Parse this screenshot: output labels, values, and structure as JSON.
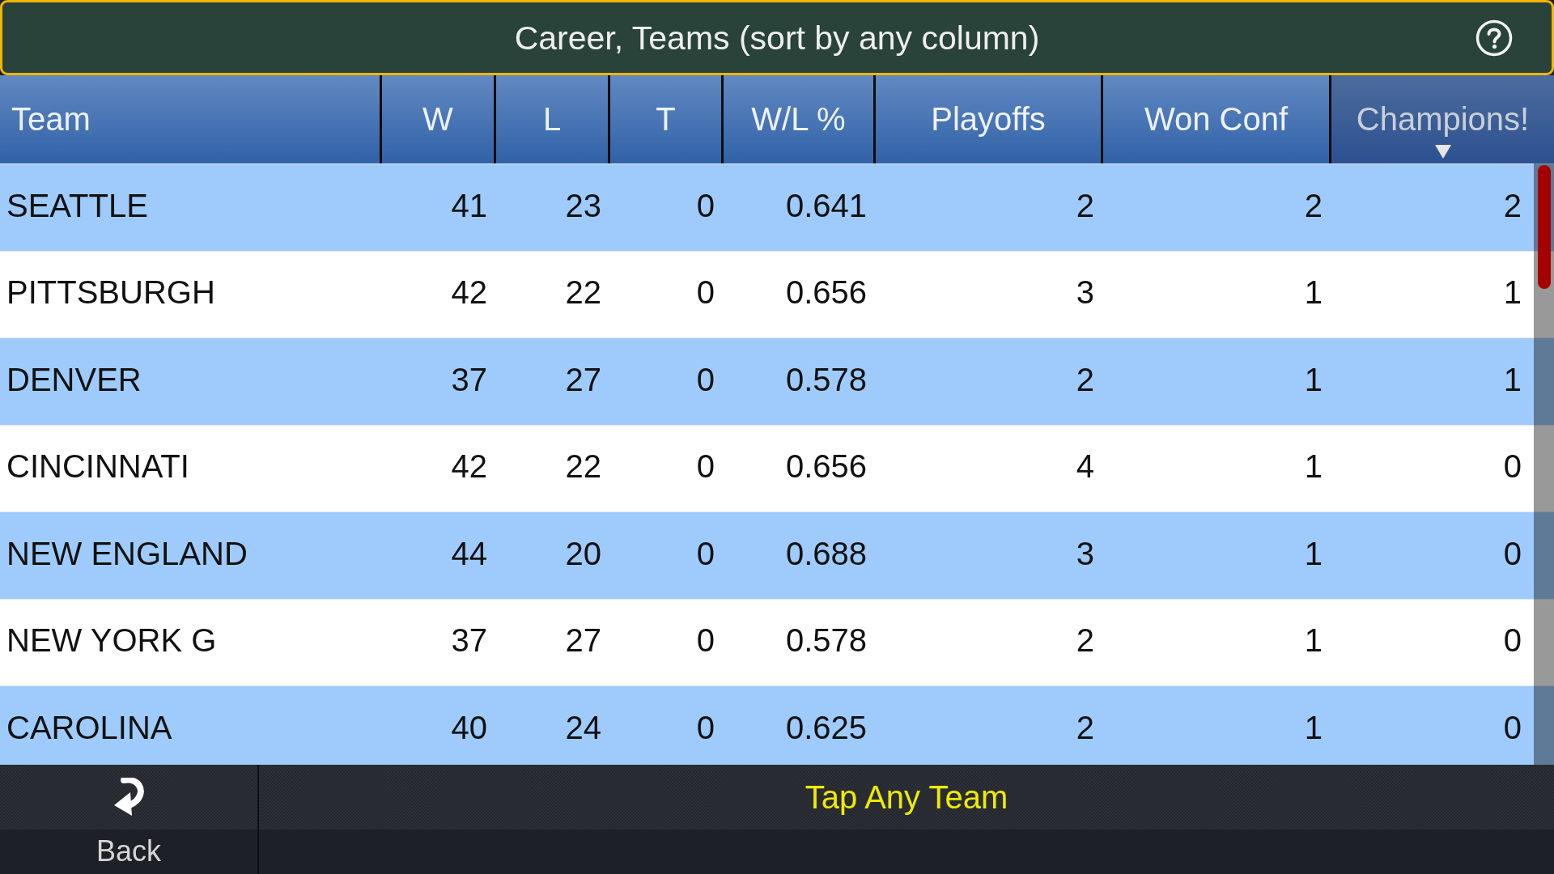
{
  "title_bar": {
    "title": "Career, Teams (sort by any column)"
  },
  "table": {
    "columns": [
      {
        "label": "Team",
        "sorted": false
      },
      {
        "label": "W",
        "sorted": false
      },
      {
        "label": "L",
        "sorted": false
      },
      {
        "label": "T",
        "sorted": false
      },
      {
        "label": "W/L %",
        "sorted": false
      },
      {
        "label": "Playoffs",
        "sorted": false
      },
      {
        "label": "Won Conf",
        "sorted": false
      },
      {
        "label": "Champions!",
        "sorted": true
      }
    ],
    "rows": [
      {
        "cells": [
          "SEATTLE",
          "41",
          "23",
          "0",
          "0.641",
          "2",
          "2",
          "2"
        ]
      },
      {
        "cells": [
          "PITTSBURGH",
          "42",
          "22",
          "0",
          "0.656",
          "3",
          "1",
          "1"
        ]
      },
      {
        "cells": [
          "DENVER",
          "37",
          "27",
          "0",
          "0.578",
          "2",
          "1",
          "1"
        ]
      },
      {
        "cells": [
          "CINCINNATI",
          "42",
          "22",
          "0",
          "0.656",
          "4",
          "1",
          "0"
        ]
      },
      {
        "cells": [
          "NEW ENGLAND",
          "44",
          "20",
          "0",
          "0.688",
          "3",
          "1",
          "0"
        ]
      },
      {
        "cells": [
          "NEW YORK G",
          "37",
          "27",
          "0",
          "0.578",
          "2",
          "1",
          "0"
        ]
      },
      {
        "cells": [
          "CAROLINA",
          "40",
          "24",
          "0",
          "0.625",
          "2",
          "1",
          "0"
        ]
      }
    ]
  },
  "footer": {
    "back_label": "Back",
    "hint": "Tap Any Team"
  }
}
